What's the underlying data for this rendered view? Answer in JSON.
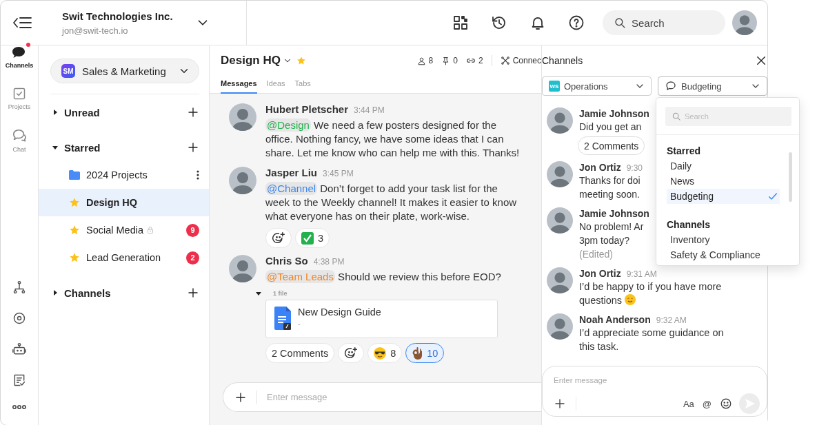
{
  "header": {
    "org_name": "Swit Technologies Inc.",
    "email": "jon@swit-tech.io",
    "search_placeholder": "Search"
  },
  "rail": [
    {
      "kind": "channels",
      "label": "Channels",
      "selected": true,
      "unread": true
    },
    {
      "kind": "projects",
      "label": "Projects",
      "selected": false,
      "unread": false
    },
    {
      "kind": "chat",
      "label": "Chat",
      "selected": false,
      "unread": false
    }
  ],
  "workspace": {
    "initials": "SM",
    "name": "Sales & Marketing"
  },
  "sections": [
    {
      "title": "Unread",
      "expanded": false
    },
    {
      "title": "Starred",
      "expanded": true,
      "items": [
        {
          "kind": "folder",
          "label": "2024 Projects",
          "selected": false,
          "locked": false
        },
        {
          "kind": "channel",
          "label": "Design HQ",
          "selected": true,
          "locked": false
        },
        {
          "kind": "channel",
          "label": "Social Media",
          "selected": false,
          "locked": true,
          "unread_count": "9"
        },
        {
          "kind": "channel",
          "label": "Lead Generation",
          "selected": false,
          "locked": false,
          "unread_count": "2"
        }
      ]
    },
    {
      "title": "Channels",
      "expanded": false
    }
  ],
  "channel": {
    "title": "Design HQ",
    "starred": true,
    "stats": [
      {
        "kind": "members",
        "value": "8"
      },
      {
        "kind": "pins",
        "value": "0"
      },
      {
        "kind": "links",
        "value": "2"
      }
    ],
    "connect": "Connec",
    "tabs": [
      {
        "label": "Messages",
        "selected": true
      },
      {
        "label": "Ideas",
        "selected": false
      },
      {
        "label": "Tabs",
        "selected": false
      }
    ]
  },
  "messages": [
    {
      "author": "Hubert Pletscher",
      "time": "3:44 PM",
      "mention": {
        "text": "@Design",
        "color": "#22b04b"
      },
      "text": "We need a few posters designed for the office. Nothing fancy, we have some ideas that I can share. Let me know who can help me with this. Thanks!"
    },
    {
      "author": "Jasper Liu",
      "time": "3:45 PM",
      "mention": {
        "text": "@Channel",
        "color": "#3a86f0"
      },
      "text": "Don’t forget to add your task list for the week to the Weekly channel! It makes it easier to know what everyone has on their plate, work-wise.",
      "reactions": [
        {
          "kind": "add",
          "selected": false
        },
        {
          "kind": "check",
          "count": "3",
          "selected": false
        }
      ]
    },
    {
      "author": "Chris So",
      "time": "4:38 PM",
      "mention": {
        "text": "@Team Leads",
        "color": "#f5821f"
      },
      "text": "Should we review this before EOD?",
      "file": {
        "count_label": "1 file",
        "name": "New Design Guide",
        "detail": "-"
      },
      "reactions": [
        {
          "kind": "comments",
          "label": "2 Comments",
          "selected": false
        },
        {
          "kind": "add",
          "selected": false
        },
        {
          "kind": "cool",
          "count": "8",
          "selected": false
        },
        {
          "kind": "ok",
          "count": "10",
          "selected": true
        }
      ]
    }
  ],
  "composer": {
    "placeholder": "Enter message"
  },
  "panel": {
    "title": "Channels",
    "workspace_select": {
      "initials": "WS",
      "label": "Operations"
    },
    "channel_select": {
      "label": "Budgeting",
      "open": true
    },
    "messages": [
      {
        "author": "Jamie Johnson",
        "lines": [
          "Did you get an"
        ],
        "comments": "2 Comments"
      },
      {
        "author": "Jon Ortiz",
        "time": "9:30",
        "lines": [
          "Thanks for doi",
          "meeting soon."
        ]
      },
      {
        "author": "Jamie Johnson",
        "lines": [
          "No problem! Ar",
          "3pm today?"
        ],
        "edited": "(Edited)"
      },
      {
        "author": "Jon Ortiz",
        "time": "9:31 AM",
        "text": "I’d be happy to if you have more questions",
        "trailing_emoji": true
      },
      {
        "author": "Noah Anderson",
        "time": "9:32 AM",
        "text": "I’d appreciate some guidance on this task."
      }
    ],
    "composer": {
      "placeholder": "Enter message",
      "format_label": "Aa",
      "mention_label": "@"
    }
  },
  "dropdown": {
    "search_placeholder": "Search",
    "groups": [
      {
        "title": "Starred",
        "items": [
          {
            "label": "Daily",
            "selected": false
          },
          {
            "label": "News",
            "selected": false
          },
          {
            "label": "Budgeting",
            "selected": true
          }
        ]
      },
      {
        "title": "Channels",
        "items": [
          {
            "label": "Inventory",
            "selected": false
          },
          {
            "label": "Safety & Compliance",
            "selected": false
          }
        ]
      }
    ]
  }
}
